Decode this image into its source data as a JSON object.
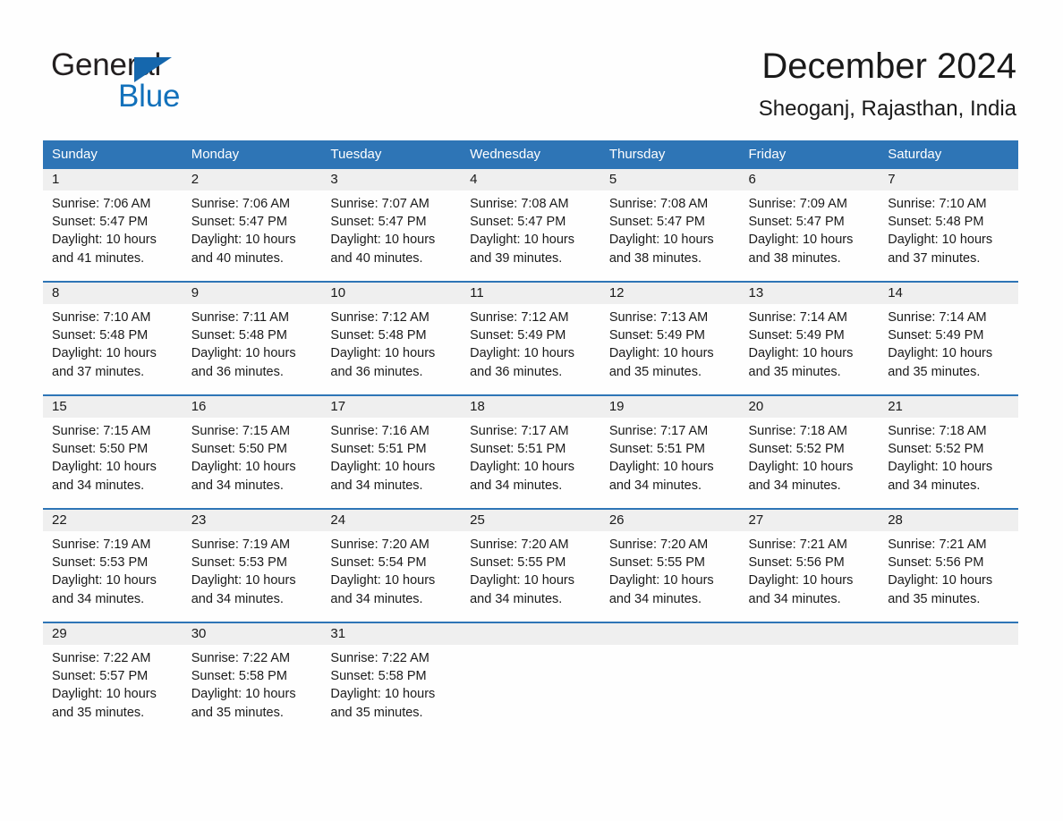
{
  "brand": {
    "name_part1": "General",
    "name_part2": "Blue",
    "logo_icon": "blue-triangle-flag",
    "accent_color": "#1271bb"
  },
  "header": {
    "title": "December 2024",
    "subtitle": "Sheoganj, Rajasthan, India"
  },
  "theme": {
    "header_blue": "#2e75b6",
    "date_band_gray": "#efefef",
    "page_background": "#fefefe",
    "text_color": "#1a1a1a"
  },
  "calendar": {
    "weekday_headers": [
      "Sunday",
      "Monday",
      "Tuesday",
      "Wednesday",
      "Thursday",
      "Friday",
      "Saturday"
    ],
    "weeks": [
      {
        "days": [
          {
            "date": "1",
            "sunrise": "Sunrise: 7:06 AM",
            "sunset": "Sunset: 5:47 PM",
            "daylight_line1": "Daylight: 10 hours",
            "daylight_line2": "and 41 minutes."
          },
          {
            "date": "2",
            "sunrise": "Sunrise: 7:06 AM",
            "sunset": "Sunset: 5:47 PM",
            "daylight_line1": "Daylight: 10 hours",
            "daylight_line2": "and 40 minutes."
          },
          {
            "date": "3",
            "sunrise": "Sunrise: 7:07 AM",
            "sunset": "Sunset: 5:47 PM",
            "daylight_line1": "Daylight: 10 hours",
            "daylight_line2": "and 40 minutes."
          },
          {
            "date": "4",
            "sunrise": "Sunrise: 7:08 AM",
            "sunset": "Sunset: 5:47 PM",
            "daylight_line1": "Daylight: 10 hours",
            "daylight_line2": "and 39 minutes."
          },
          {
            "date": "5",
            "sunrise": "Sunrise: 7:08 AM",
            "sunset": "Sunset: 5:47 PM",
            "daylight_line1": "Daylight: 10 hours",
            "daylight_line2": "and 38 minutes."
          },
          {
            "date": "6",
            "sunrise": "Sunrise: 7:09 AM",
            "sunset": "Sunset: 5:47 PM",
            "daylight_line1": "Daylight: 10 hours",
            "daylight_line2": "and 38 minutes."
          },
          {
            "date": "7",
            "sunrise": "Sunrise: 7:10 AM",
            "sunset": "Sunset: 5:48 PM",
            "daylight_line1": "Daylight: 10 hours",
            "daylight_line2": "and 37 minutes."
          }
        ]
      },
      {
        "days": [
          {
            "date": "8",
            "sunrise": "Sunrise: 7:10 AM",
            "sunset": "Sunset: 5:48 PM",
            "daylight_line1": "Daylight: 10 hours",
            "daylight_line2": "and 37 minutes."
          },
          {
            "date": "9",
            "sunrise": "Sunrise: 7:11 AM",
            "sunset": "Sunset: 5:48 PM",
            "daylight_line1": "Daylight: 10 hours",
            "daylight_line2": "and 36 minutes."
          },
          {
            "date": "10",
            "sunrise": "Sunrise: 7:12 AM",
            "sunset": "Sunset: 5:48 PM",
            "daylight_line1": "Daylight: 10 hours",
            "daylight_line2": "and 36 minutes."
          },
          {
            "date": "11",
            "sunrise": "Sunrise: 7:12 AM",
            "sunset": "Sunset: 5:49 PM",
            "daylight_line1": "Daylight: 10 hours",
            "daylight_line2": "and 36 minutes."
          },
          {
            "date": "12",
            "sunrise": "Sunrise: 7:13 AM",
            "sunset": "Sunset: 5:49 PM",
            "daylight_line1": "Daylight: 10 hours",
            "daylight_line2": "and 35 minutes."
          },
          {
            "date": "13",
            "sunrise": "Sunrise: 7:14 AM",
            "sunset": "Sunset: 5:49 PM",
            "daylight_line1": "Daylight: 10 hours",
            "daylight_line2": "and 35 minutes."
          },
          {
            "date": "14",
            "sunrise": "Sunrise: 7:14 AM",
            "sunset": "Sunset: 5:49 PM",
            "daylight_line1": "Daylight: 10 hours",
            "daylight_line2": "and 35 minutes."
          }
        ]
      },
      {
        "days": [
          {
            "date": "15",
            "sunrise": "Sunrise: 7:15 AM",
            "sunset": "Sunset: 5:50 PM",
            "daylight_line1": "Daylight: 10 hours",
            "daylight_line2": "and 34 minutes."
          },
          {
            "date": "16",
            "sunrise": "Sunrise: 7:15 AM",
            "sunset": "Sunset: 5:50 PM",
            "daylight_line1": "Daylight: 10 hours",
            "daylight_line2": "and 34 minutes."
          },
          {
            "date": "17",
            "sunrise": "Sunrise: 7:16 AM",
            "sunset": "Sunset: 5:51 PM",
            "daylight_line1": "Daylight: 10 hours",
            "daylight_line2": "and 34 minutes."
          },
          {
            "date": "18",
            "sunrise": "Sunrise: 7:17 AM",
            "sunset": "Sunset: 5:51 PM",
            "daylight_line1": "Daylight: 10 hours",
            "daylight_line2": "and 34 minutes."
          },
          {
            "date": "19",
            "sunrise": "Sunrise: 7:17 AM",
            "sunset": "Sunset: 5:51 PM",
            "daylight_line1": "Daylight: 10 hours",
            "daylight_line2": "and 34 minutes."
          },
          {
            "date": "20",
            "sunrise": "Sunrise: 7:18 AM",
            "sunset": "Sunset: 5:52 PM",
            "daylight_line1": "Daylight: 10 hours",
            "daylight_line2": "and 34 minutes."
          },
          {
            "date": "21",
            "sunrise": "Sunrise: 7:18 AM",
            "sunset": "Sunset: 5:52 PM",
            "daylight_line1": "Daylight: 10 hours",
            "daylight_line2": "and 34 minutes."
          }
        ]
      },
      {
        "days": [
          {
            "date": "22",
            "sunrise": "Sunrise: 7:19 AM",
            "sunset": "Sunset: 5:53 PM",
            "daylight_line1": "Daylight: 10 hours",
            "daylight_line2": "and 34 minutes."
          },
          {
            "date": "23",
            "sunrise": "Sunrise: 7:19 AM",
            "sunset": "Sunset: 5:53 PM",
            "daylight_line1": "Daylight: 10 hours",
            "daylight_line2": "and 34 minutes."
          },
          {
            "date": "24",
            "sunrise": "Sunrise: 7:20 AM",
            "sunset": "Sunset: 5:54 PM",
            "daylight_line1": "Daylight: 10 hours",
            "daylight_line2": "and 34 minutes."
          },
          {
            "date": "25",
            "sunrise": "Sunrise: 7:20 AM",
            "sunset": "Sunset: 5:55 PM",
            "daylight_line1": "Daylight: 10 hours",
            "daylight_line2": "and 34 minutes."
          },
          {
            "date": "26",
            "sunrise": "Sunrise: 7:20 AM",
            "sunset": "Sunset: 5:55 PM",
            "daylight_line1": "Daylight: 10 hours",
            "daylight_line2": "and 34 minutes."
          },
          {
            "date": "27",
            "sunrise": "Sunrise: 7:21 AM",
            "sunset": "Sunset: 5:56 PM",
            "daylight_line1": "Daylight: 10 hours",
            "daylight_line2": "and 34 minutes."
          },
          {
            "date": "28",
            "sunrise": "Sunrise: 7:21 AM",
            "sunset": "Sunset: 5:56 PM",
            "daylight_line1": "Daylight: 10 hours",
            "daylight_line2": "and 35 minutes."
          }
        ]
      },
      {
        "days": [
          {
            "date": "29",
            "sunrise": "Sunrise: 7:22 AM",
            "sunset": "Sunset: 5:57 PM",
            "daylight_line1": "Daylight: 10 hours",
            "daylight_line2": "and 35 minutes."
          },
          {
            "date": "30",
            "sunrise": "Sunrise: 7:22 AM",
            "sunset": "Sunset: 5:58 PM",
            "daylight_line1": "Daylight: 10 hours",
            "daylight_line2": "and 35 minutes."
          },
          {
            "date": "31",
            "sunrise": "Sunrise: 7:22 AM",
            "sunset": "Sunset: 5:58 PM",
            "daylight_line1": "Daylight: 10 hours",
            "daylight_line2": "and 35 minutes."
          },
          {
            "date": "",
            "sunrise": "",
            "sunset": "",
            "daylight_line1": "",
            "daylight_line2": ""
          },
          {
            "date": "",
            "sunrise": "",
            "sunset": "",
            "daylight_line1": "",
            "daylight_line2": ""
          },
          {
            "date": "",
            "sunrise": "",
            "sunset": "",
            "daylight_line1": "",
            "daylight_line2": ""
          },
          {
            "date": "",
            "sunrise": "",
            "sunset": "",
            "daylight_line1": "",
            "daylight_line2": ""
          }
        ]
      }
    ]
  }
}
